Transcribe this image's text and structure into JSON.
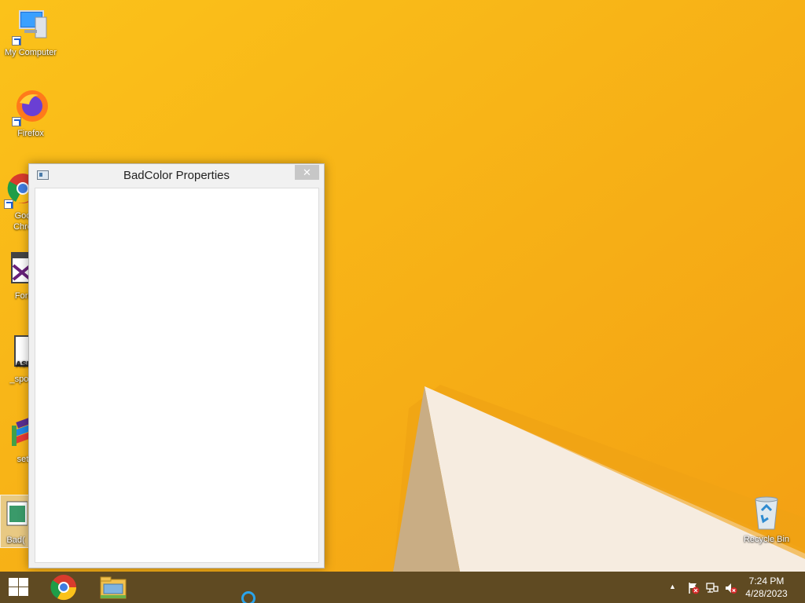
{
  "desktop": {
    "icons": [
      {
        "label": "My Computer"
      },
      {
        "label": "Firefox"
      },
      {
        "label": "Goo\nChro"
      },
      {
        "label": "Forr"
      },
      {
        "label": "_spoof"
      },
      {
        "label": "set"
      },
      {
        "label": "Bad("
      },
      {
        "label": "Recycle Bin"
      }
    ]
  },
  "window": {
    "title": "BadColor Properties",
    "close_glyph": "✕"
  },
  "taskbar": {
    "pinned": [
      {
        "name": "chrome"
      },
      {
        "name": "file-explorer"
      }
    ],
    "tray": {
      "overflow_glyph": "▲",
      "time": "7:24 PM",
      "date": "4/28/2023"
    }
  },
  "colors": {
    "wallpaper": "#f9b21a",
    "taskbar": "#5f4a22",
    "accent": "#2aa3ea"
  }
}
